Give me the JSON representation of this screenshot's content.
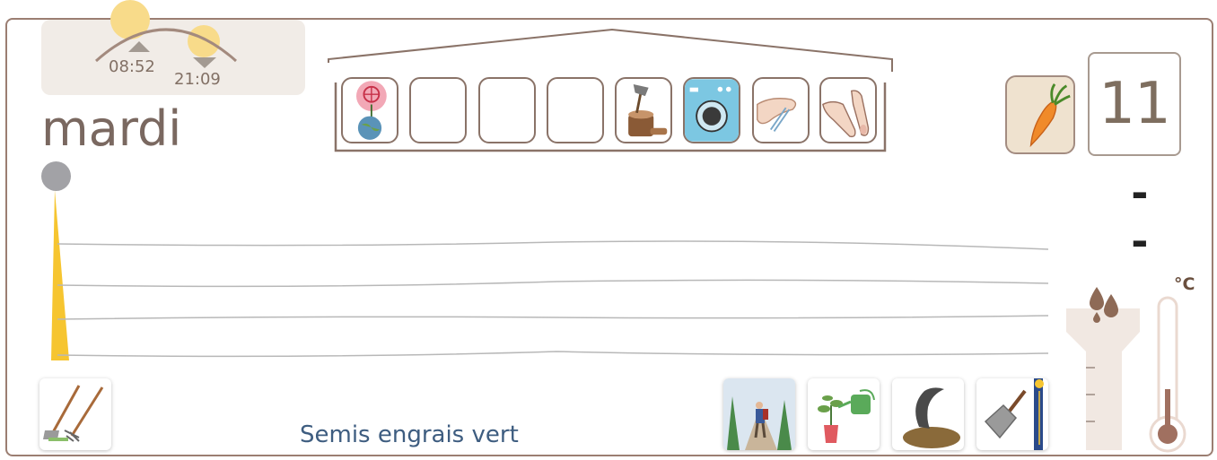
{
  "sun": {
    "sunrise": "08:52",
    "sunset": "21:09",
    "colors": {
      "sun": "#f8db8a",
      "arc": "#a38a7e",
      "panel": "#f1ece7"
    }
  },
  "day": {
    "name": "mardi",
    "number": "11",
    "moon_phase": "- -"
  },
  "house": {
    "slots": [
      {
        "icon": "earth-flower-icon",
        "empty": false
      },
      {
        "icon": "",
        "empty": true
      },
      {
        "icon": "",
        "empty": true
      },
      {
        "icon": "",
        "empty": true
      },
      {
        "icon": "axe-stump-icon",
        "empty": false
      },
      {
        "icon": "washing-machine-icon",
        "empty": false
      },
      {
        "icon": "hand-tweezers-icon",
        "empty": false
      },
      {
        "icon": "hand-finger-icon",
        "empty": false
      }
    ]
  },
  "plant": {
    "icon": "carrot-icon"
  },
  "tools": {
    "left": {
      "icon": "hoe-rake-icon"
    },
    "right": [
      {
        "icon": "hiker-path-icon"
      },
      {
        "icon": "watering-can-icon"
      },
      {
        "icon": "horn-manure-icon"
      },
      {
        "icon": "spade-icon"
      }
    ]
  },
  "activity": {
    "label": "Semis engrais vert"
  },
  "weather": {
    "temperature_unit": "°C",
    "rain_icon": "rain-drops-icon",
    "thermometer_icon": "thermometer-icon"
  },
  "colors": {
    "frame": "#9b7e72",
    "accent_yellow": "#f6c530",
    "label_blue": "#3e5d80",
    "text_brown": "#7a6860"
  }
}
